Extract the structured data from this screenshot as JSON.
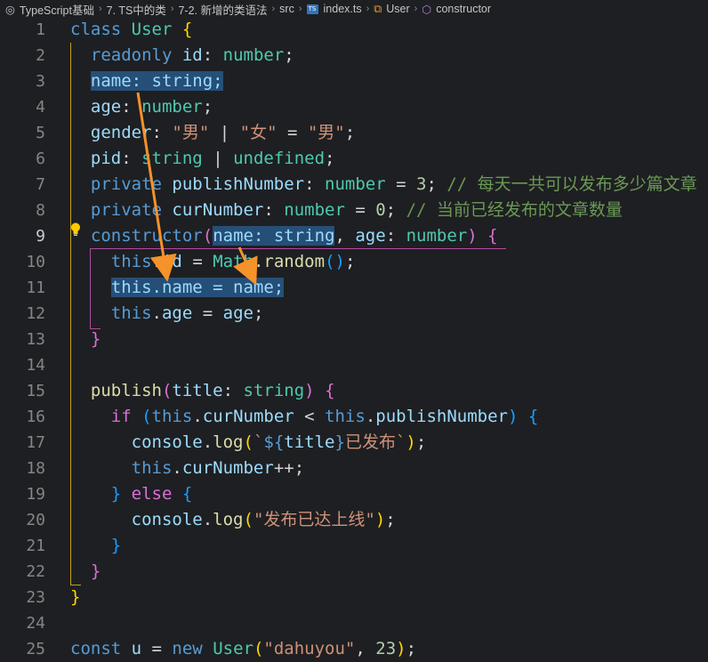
{
  "breadcrumb": {
    "items": [
      "TypeScript基础",
      "7. TS中的类",
      "7-2. 新增的类语法",
      "src",
      "index.ts",
      "User",
      "constructor"
    ],
    "icons": [
      "folder-circle-icon",
      null,
      null,
      null,
      "ts-file-icon",
      "class-icon",
      "method-cube-icon"
    ]
  },
  "lines": [
    {
      "n": "1",
      "t": [
        [
          "class ",
          "kw"
        ],
        [
          "User ",
          "ty"
        ],
        [
          "{",
          "b1"
        ]
      ]
    },
    {
      "n": "2",
      "t": [
        [
          "  "
        ],
        [
          "readonly ",
          "kw"
        ],
        [
          "id",
          "pr"
        ],
        [
          ": "
        ],
        [
          "number",
          "ty"
        ],
        [
          ";"
        ]
      ]
    },
    {
      "n": "3",
      "t": [
        [
          "  "
        ],
        [
          "name: string;",
          "hl pr"
        ]
      ]
    },
    {
      "n": "4",
      "t": [
        [
          "  "
        ],
        [
          "age",
          "pr"
        ],
        [
          ": "
        ],
        [
          "number",
          "ty"
        ],
        [
          ";"
        ]
      ]
    },
    {
      "n": "5",
      "t": [
        [
          "  "
        ],
        [
          "gender",
          "pr"
        ],
        [
          ": "
        ],
        [
          "\"男\"",
          "st"
        ],
        [
          " | "
        ],
        [
          "\"女\"",
          "st"
        ],
        [
          " = "
        ],
        [
          "\"男\"",
          "st"
        ],
        [
          ";"
        ]
      ]
    },
    {
      "n": "6",
      "t": [
        [
          "  "
        ],
        [
          "pid",
          "pr"
        ],
        [
          ": "
        ],
        [
          "string",
          "ty"
        ],
        [
          " | "
        ],
        [
          "undefined",
          "ty"
        ],
        [
          ";"
        ]
      ]
    },
    {
      "n": "7",
      "t": [
        [
          "  "
        ],
        [
          "private ",
          "kw"
        ],
        [
          "publishNumber",
          "pr"
        ],
        [
          ": "
        ],
        [
          "number",
          "ty"
        ],
        [
          " = "
        ],
        [
          "3",
          "nu"
        ],
        [
          "; "
        ],
        [
          "// 每天一共可以发布多少篇文章",
          "cm"
        ]
      ]
    },
    {
      "n": "8",
      "t": [
        [
          "  "
        ],
        [
          "private ",
          "kw"
        ],
        [
          "curNumber",
          "pr"
        ],
        [
          ": "
        ],
        [
          "number",
          "ty"
        ],
        [
          " = "
        ],
        [
          "0",
          "nu"
        ],
        [
          "; "
        ],
        [
          "// 当前已经发布的文章数量",
          "cm"
        ]
      ]
    },
    {
      "n": "9",
      "active": true,
      "t": [
        [
          "  "
        ],
        [
          "constructor",
          "kw"
        ],
        [
          "(",
          "b2"
        ],
        [
          "name: string",
          "hl pr"
        ],
        [
          ", "
        ],
        [
          "age",
          "pr"
        ],
        [
          ": "
        ],
        [
          "number",
          "ty"
        ],
        [
          ")",
          "b2"
        ],
        [
          " "
        ],
        [
          "{",
          "b2"
        ]
      ]
    },
    {
      "n": "10",
      "t": [
        [
          "    "
        ],
        [
          "this",
          "th"
        ],
        [
          "."
        ],
        [
          "id",
          "pr"
        ],
        [
          " = "
        ],
        [
          "Math",
          "ty"
        ],
        [
          "."
        ],
        [
          "random",
          "fn"
        ],
        [
          "()",
          "b3"
        ],
        [
          ";"
        ]
      ]
    },
    {
      "n": "11",
      "t": [
        [
          "    "
        ],
        [
          "this.name = name;",
          "hl pr"
        ]
      ]
    },
    {
      "n": "12",
      "t": [
        [
          "    "
        ],
        [
          "this",
          "th"
        ],
        [
          "."
        ],
        [
          "age",
          "pr"
        ],
        [
          " = "
        ],
        [
          "age",
          "pr"
        ],
        [
          ";"
        ]
      ]
    },
    {
      "n": "13",
      "t": [
        [
          "  "
        ],
        [
          "}",
          "b2"
        ]
      ]
    },
    {
      "n": "14",
      "t": []
    },
    {
      "n": "15",
      "t": [
        [
          "  "
        ],
        [
          "publish",
          "fn"
        ],
        [
          "(",
          "b2"
        ],
        [
          "title",
          "pr"
        ],
        [
          ": "
        ],
        [
          "string",
          "ty"
        ],
        [
          ")",
          "b2"
        ],
        [
          " "
        ],
        [
          "{",
          "b2"
        ]
      ]
    },
    {
      "n": "16",
      "t": [
        [
          "    "
        ],
        [
          "if ",
          "b2"
        ],
        [
          "(",
          "b3"
        ],
        [
          "this",
          "th"
        ],
        [
          "."
        ],
        [
          "curNumber",
          "pr"
        ],
        [
          " < "
        ],
        [
          "this",
          "th"
        ],
        [
          "."
        ],
        [
          "publishNumber",
          "pr"
        ],
        [
          ")",
          "b3"
        ],
        [
          " "
        ],
        [
          "{",
          "b3"
        ]
      ]
    },
    {
      "n": "17",
      "t": [
        [
          "      "
        ],
        [
          "console",
          "pr"
        ],
        [
          "."
        ],
        [
          "log",
          "fn"
        ],
        [
          "(",
          "b1"
        ],
        [
          "`",
          "st"
        ],
        [
          "${",
          "kw"
        ],
        [
          "title",
          "pr"
        ],
        [
          "}",
          "kw"
        ],
        [
          "已发布`",
          "st"
        ],
        [
          ")",
          "b1"
        ],
        [
          ";"
        ]
      ]
    },
    {
      "n": "18",
      "t": [
        [
          "      "
        ],
        [
          "this",
          "th"
        ],
        [
          "."
        ],
        [
          "curNumber",
          "pr"
        ],
        [
          "++;"
        ]
      ]
    },
    {
      "n": "19",
      "t": [
        [
          "    "
        ],
        [
          "}",
          "b3"
        ],
        [
          " "
        ],
        [
          "else ",
          "b2"
        ],
        [
          "{",
          "b3"
        ]
      ]
    },
    {
      "n": "20",
      "t": [
        [
          "      "
        ],
        [
          "console",
          "pr"
        ],
        [
          "."
        ],
        [
          "log",
          "fn"
        ],
        [
          "(",
          "b1"
        ],
        [
          "\"发布已达上线\"",
          "st"
        ],
        [
          ")",
          "b1"
        ],
        [
          ";"
        ]
      ]
    },
    {
      "n": "21",
      "t": [
        [
          "    "
        ],
        [
          "}",
          "b3"
        ]
      ]
    },
    {
      "n": "22",
      "t": [
        [
          "  "
        ],
        [
          "}",
          "b2"
        ]
      ]
    },
    {
      "n": "23",
      "t": [
        [
          "}",
          "b1"
        ]
      ]
    },
    {
      "n": "24",
      "t": []
    },
    {
      "n": "25",
      "t": [
        [
          "const ",
          "kw"
        ],
        [
          "u",
          "pr"
        ],
        [
          " = "
        ],
        [
          "new ",
          "kw"
        ],
        [
          "User",
          "ty"
        ],
        [
          "(",
          "b1"
        ],
        [
          "\"dahuyou\"",
          "st"
        ],
        [
          ", "
        ],
        [
          "23",
          "nu"
        ],
        [
          ")",
          "b1"
        ],
        [
          ";"
        ]
      ]
    }
  ],
  "colors": {
    "background": "#1e1f22",
    "selection": "#264f78",
    "arrow": "#f5922a",
    "scope_guide_yellow": "#c4a21a",
    "scope_guide_magenta": "#b04aa0"
  }
}
